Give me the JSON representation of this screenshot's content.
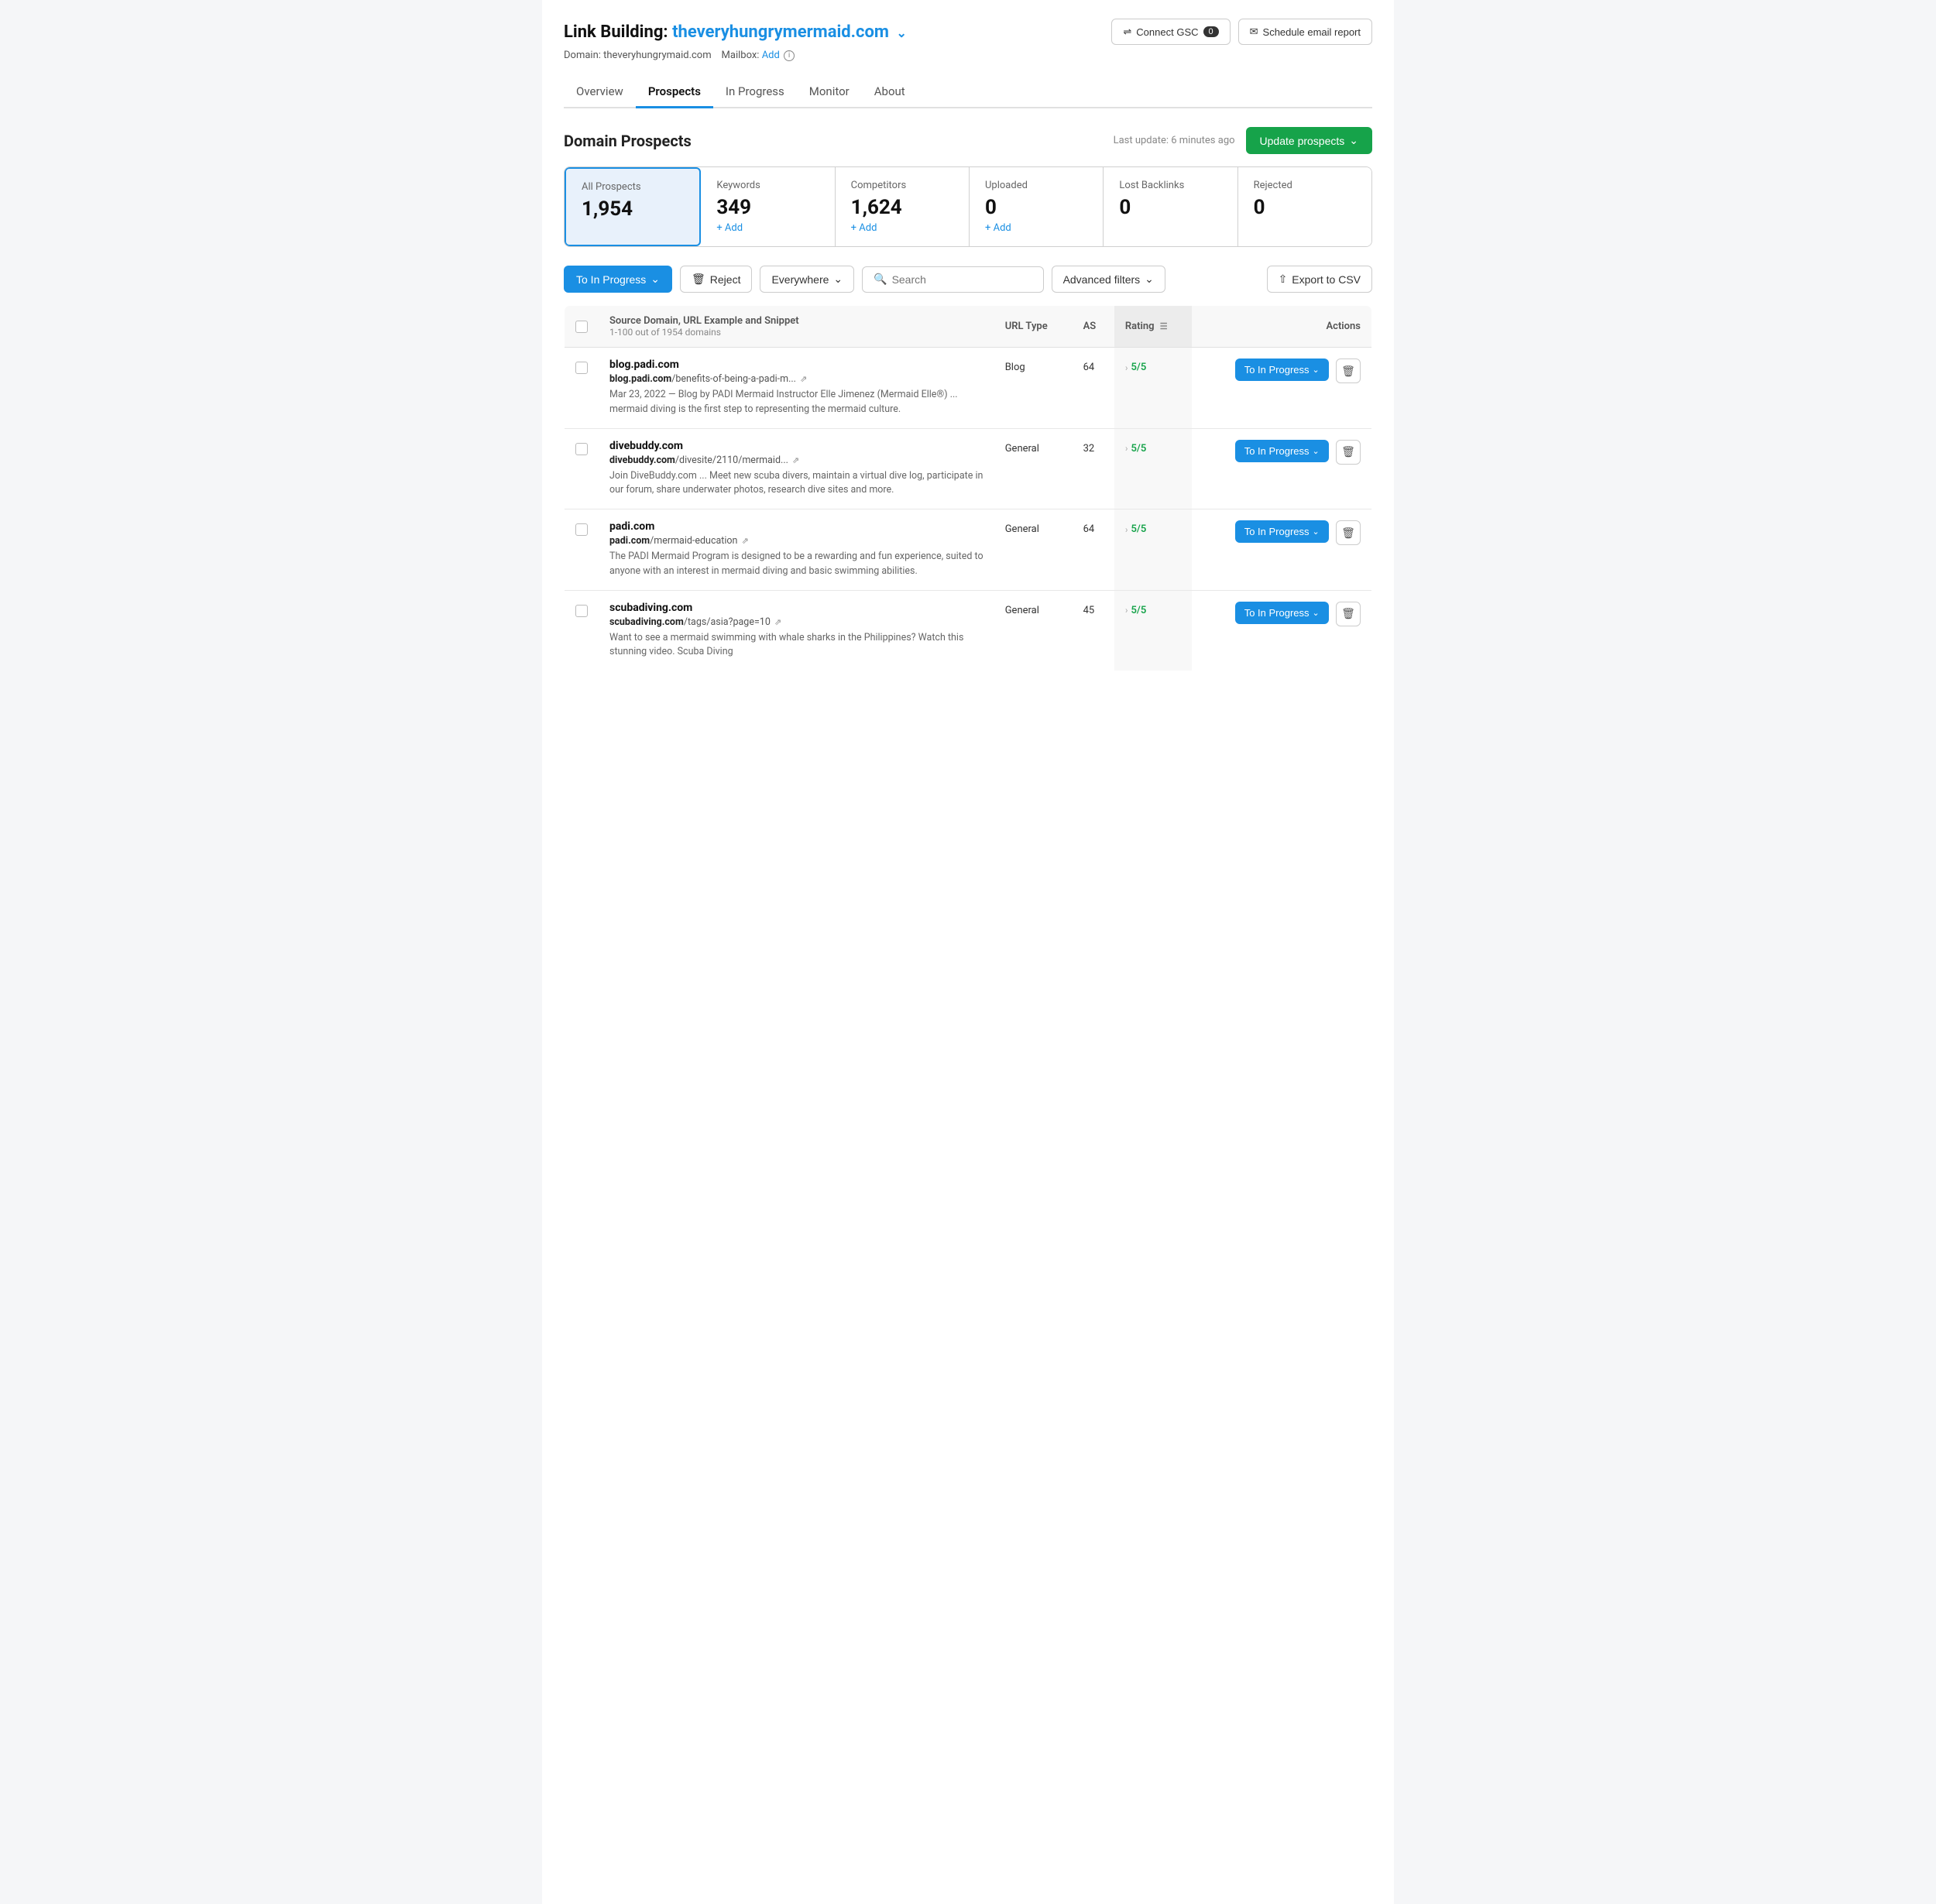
{
  "header": {
    "title_prefix": "Link Building: ",
    "domain_name": "theveryhungrymermaid.com",
    "domain_label": "Domain: theveryhungrymaid.com",
    "domain_display": "theveryhungrymermaid.com",
    "mailbox_label": "Mailbox:",
    "mailbox_add": "Add",
    "connect_gsc_label": "Connect GSC",
    "connect_gsc_count": "0",
    "schedule_email_label": "Schedule email report"
  },
  "tabs": [
    {
      "label": "Overview",
      "active": false
    },
    {
      "label": "Prospects",
      "active": true
    },
    {
      "label": "In Progress",
      "active": false
    },
    {
      "label": "Monitor",
      "active": false
    },
    {
      "label": "About",
      "active": false
    }
  ],
  "section": {
    "title": "Domain Prospects",
    "last_update": "Last update: 6 minutes ago",
    "update_btn": "Update prospects"
  },
  "stats": [
    {
      "label": "All Prospects",
      "value": "1,954",
      "add": null,
      "active": true
    },
    {
      "label": "Keywords",
      "value": "349",
      "add": "+ Add",
      "active": false
    },
    {
      "label": "Competitors",
      "value": "1,624",
      "add": "+ Add",
      "active": false
    },
    {
      "label": "Uploaded",
      "value": "0",
      "add": "+ Add",
      "active": false
    },
    {
      "label": "Lost Backlinks",
      "value": "0",
      "add": null,
      "active": false
    },
    {
      "label": "Rejected",
      "value": "0",
      "add": null,
      "active": false
    }
  ],
  "toolbar": {
    "to_in_progress": "To In Progress",
    "reject": "Reject",
    "everywhere": "Everywhere",
    "search_placeholder": "Search",
    "advanced_filters": "Advanced filters",
    "export_csv": "Export to CSV"
  },
  "table": {
    "columns": [
      {
        "label": "",
        "key": "check"
      },
      {
        "label": "Source Domain, URL Example and Snippet",
        "sub": "1-100 out of 1954 domains",
        "key": "source"
      },
      {
        "label": "URL Type",
        "key": "type"
      },
      {
        "label": "AS",
        "key": "as"
      },
      {
        "label": "Rating",
        "key": "rating",
        "sortable": true
      },
      {
        "label": "Actions",
        "key": "actions"
      }
    ],
    "rows": [
      {
        "domain": "blog.padi.com",
        "url": "https://blog.padi.com/benefits-of-being-a-padi-m...",
        "url_bold": "blog.padi.com",
        "url_rest": "/benefits-of-being-a-padi-m...",
        "snippet": "Mar 23, 2022 — Blog by PADI Mermaid Instructor Elle Jimenez (Mermaid Elle®) ... mermaid diving is the first step to representing the mermaid culture.",
        "type": "Blog",
        "as": "64",
        "rating": "5/5",
        "action": "To In Progress"
      },
      {
        "domain": "divebuddy.com",
        "url": "http://www.divebuddy.com/divesite/2110/mermaid...",
        "url_bold": "divebuddy.com",
        "url_rest": "/divesite/2110/mermaid...",
        "snippet": "Join DiveBuddy.com ... Meet new scuba divers, maintain a virtual dive log, participate in our forum, share underwater photos, research dive sites and more.",
        "type": "General",
        "as": "32",
        "rating": "5/5",
        "action": "To In Progress"
      },
      {
        "domain": "padi.com",
        "url": "https://www.padi.com/mermaid-education",
        "url_bold": "padi.com",
        "url_rest": "/mermaid-education",
        "snippet": "The PADI Mermaid Program is designed to be a rewarding and fun experience, suited to anyone with an interest in mermaid diving and basic swimming abilities.",
        "type": "General",
        "as": "64",
        "rating": "5/5",
        "action": "To In Progress"
      },
      {
        "domain": "scubadiving.com",
        "url": "https://www.scubadiving.com/tags/asia?page=10",
        "url_bold": "scubadiving.com",
        "url_rest": "/tags/asia?page=10",
        "snippet": "Want to see a mermaid swimming with whale sharks in the Philippines? Watch this stunning video. Scuba Diving",
        "type": "General",
        "as": "45",
        "rating": "5/5",
        "action": "To In Progress"
      }
    ]
  }
}
